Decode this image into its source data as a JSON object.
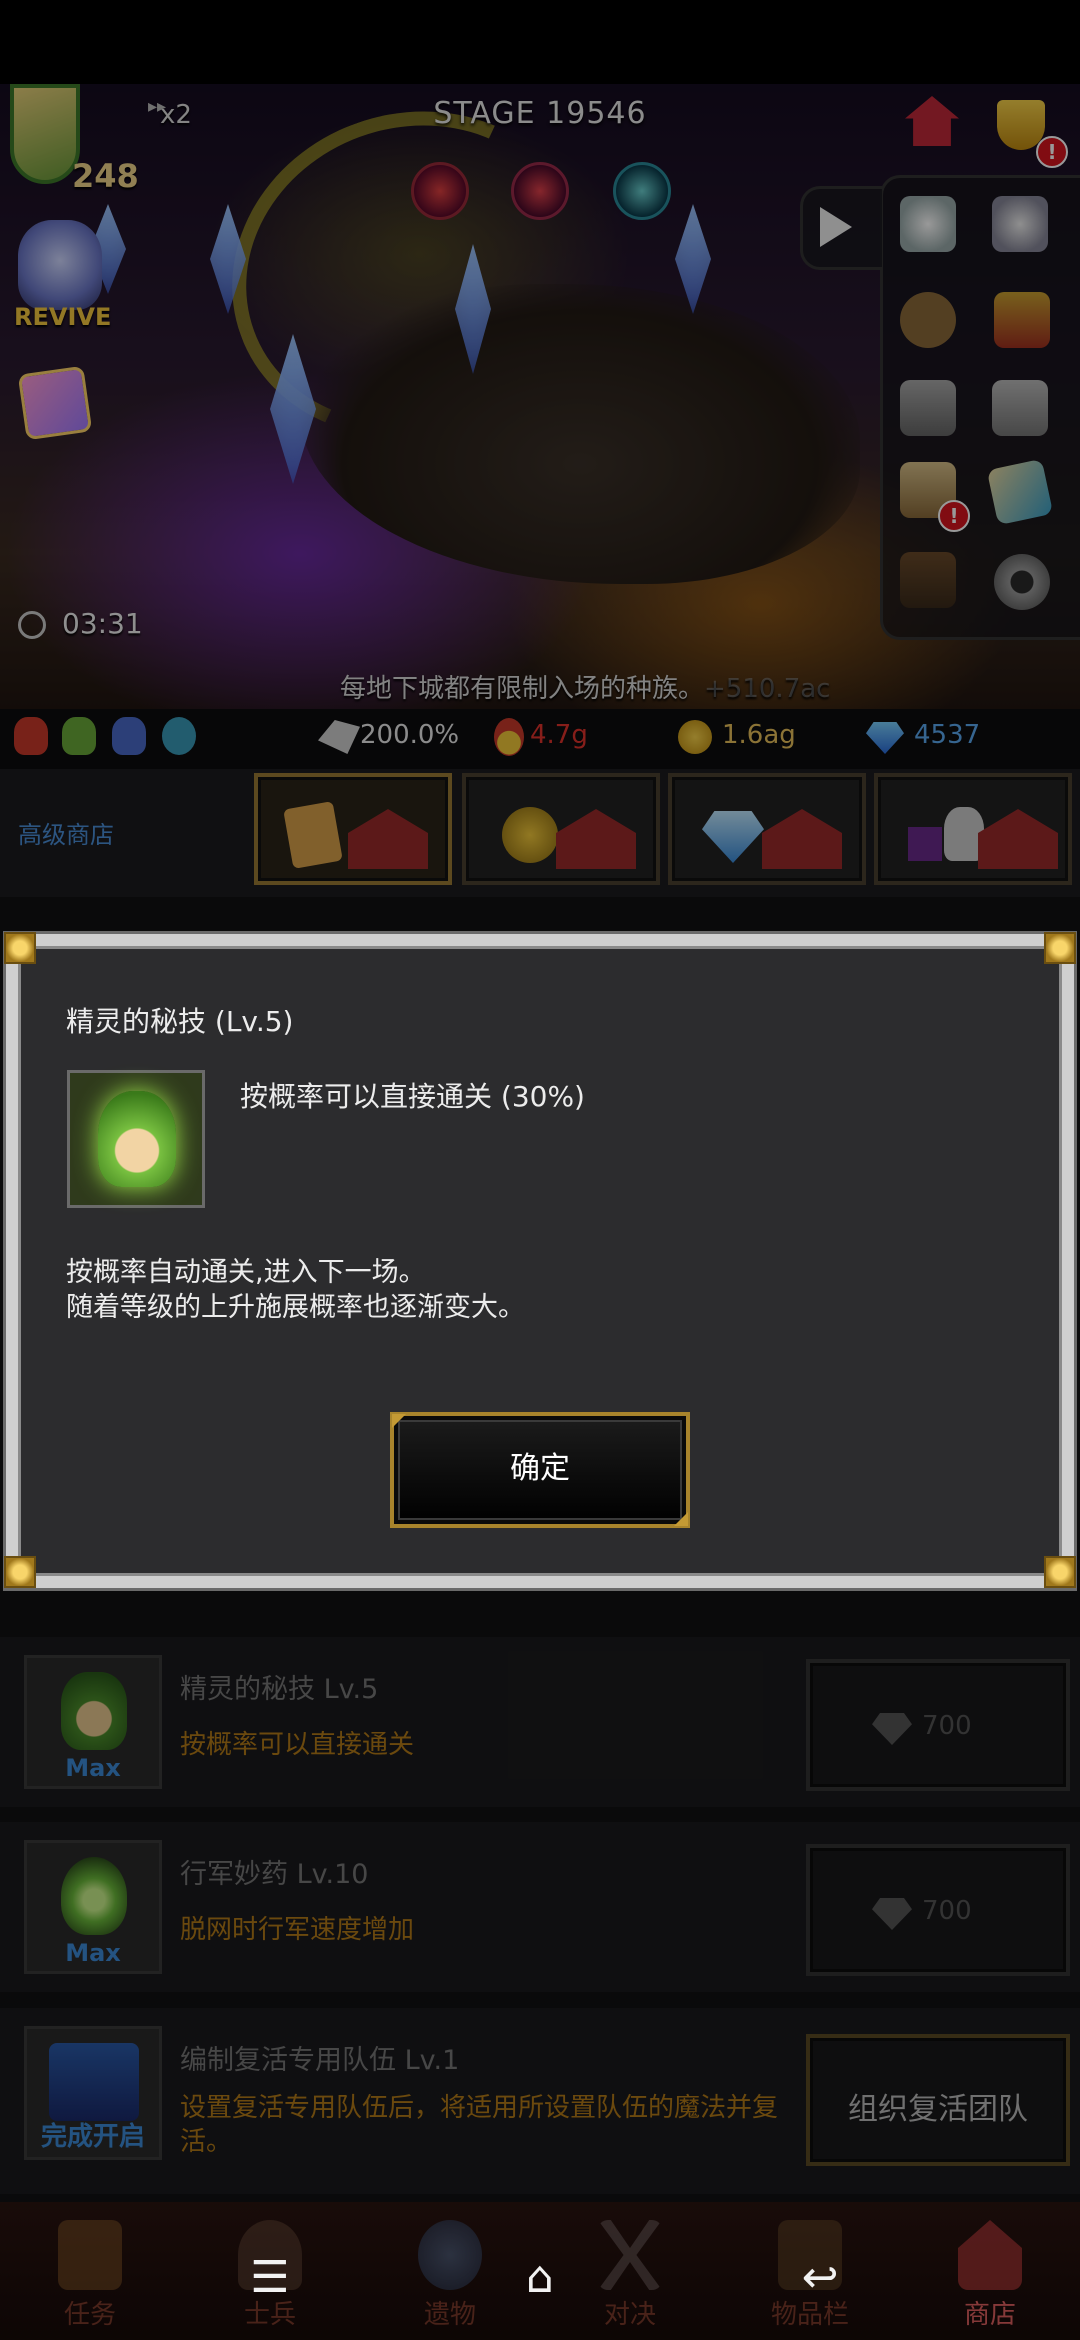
{
  "game": {
    "stage_label": "STAGE 19546",
    "speed_label": "x2",
    "hero_level": "248",
    "revive_label": "REVIVE",
    "timer": "03:31",
    "tip_text": "每地下城都有限制入场的种族。",
    "tip_overlay": "+510.7ac",
    "alert_mark": "!"
  },
  "resources": {
    "bonus": "200.0%",
    "gold": "4.7g",
    "coin": "1.6ag",
    "gems": "4537"
  },
  "shop": {
    "label": "高级商店",
    "tabs": [
      "scroll-shop",
      "coin-shop",
      "gem-shop",
      "item-shop"
    ]
  },
  "list": {
    "items": [
      {
        "title": "精灵的秘技 Lv.5",
        "desc": "按概率可以直接通关",
        "badge": "Max",
        "price": "700"
      },
      {
        "title": "行军妙药 Lv.10",
        "desc": "脱网时行军速度增加",
        "badge": "Max",
        "price": "700"
      },
      {
        "title": "编制复活专用队伍 Lv.1",
        "desc": "设置复活专用队伍后，将适用所设置队伍的魔法并复活。",
        "badge": "完成开启",
        "button": "组织复活团队"
      }
    ]
  },
  "dialog": {
    "title": "精灵的秘技 (Lv.5)",
    "effect": "按概率可以直接通关 (30%)",
    "desc_line1": "按概率自动通关,进入下一场。",
    "desc_line2": "随着等级的上升施展概率也逐渐变大。",
    "confirm": "确定"
  },
  "nav": {
    "items": [
      "任务",
      "士兵",
      "遗物",
      "对决",
      "物品栏",
      "商店"
    ],
    "active": "商店"
  },
  "colors": {
    "accent_blue": "#4a8ed8",
    "gold_text": "#b27a18",
    "gold_border": "#a8842c",
    "alert_red": "#d8141e"
  }
}
